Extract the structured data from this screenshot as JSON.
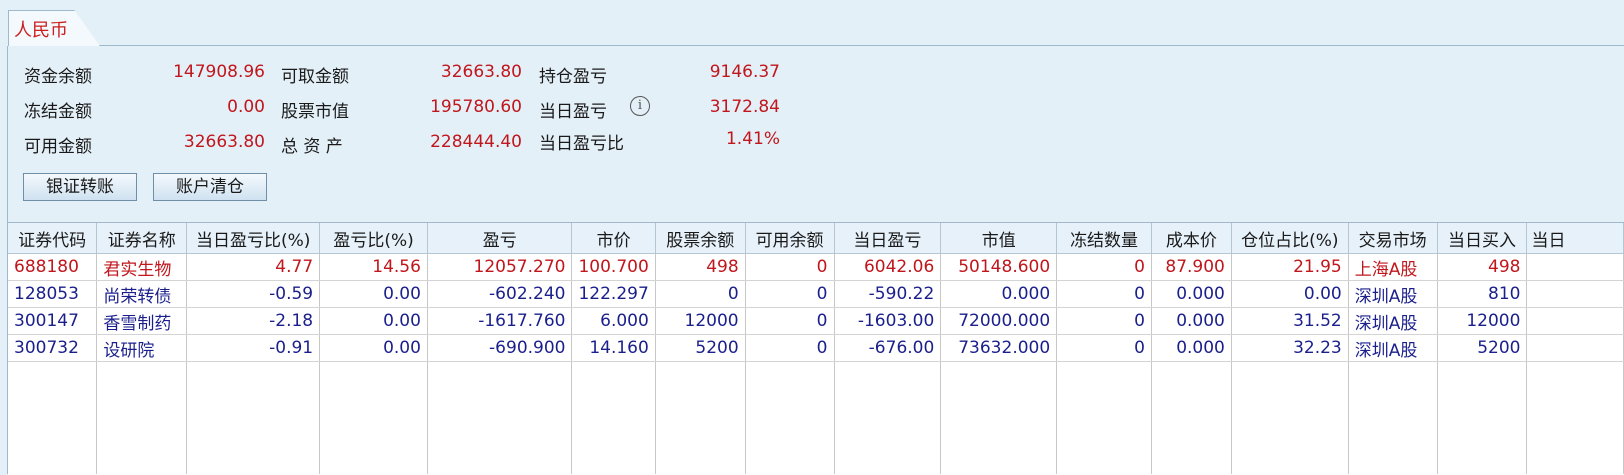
{
  "currency_tab": "人民币",
  "summary": {
    "zijin_label": "资金余额",
    "zijin_value": "147908.96",
    "dongjie_label": "冻结金额",
    "dongjie_value": "0.00",
    "keyong_label": "可用金额",
    "keyong_value": "32663.80",
    "kequ_label": "可取金额",
    "kequ_value": "32663.80",
    "gupiao_label": "股票市值",
    "gupiao_value": "195780.60",
    "zongzichan_label": "总 资 产",
    "zongzichan_value": "228444.40",
    "chicang_label": "持仓盈亏",
    "chicang_value": "9146.37",
    "dangri_label": "当日盈亏",
    "dangri_value": "3172.84",
    "dangribi_label": "当日盈亏比",
    "dangribi_value": "1.41%"
  },
  "buttons": {
    "transfer": "银证转账",
    "clear": "账户清仓"
  },
  "table": {
    "headers": [
      "证券代码",
      "证券名称",
      "当日盈亏比(%)",
      "盈亏比(%)",
      "盈亏",
      "市价",
      "股票余额",
      "可用余额",
      "当日盈亏",
      "市值",
      "冻结数量",
      "成本价",
      "仓位占比(%)",
      "交易市场",
      "当日买入",
      "当日"
    ],
    "rows": [
      [
        "688180",
        "君实生物",
        "4.77",
        "14.56",
        "12057.270",
        "100.700",
        "498",
        "0",
        "6042.06",
        "50148.600",
        "0",
        "87.900",
        "21.95",
        "上海A股",
        "498",
        ""
      ],
      [
        "128053",
        "尚荣转债",
        "-0.59",
        "0.00",
        "-602.240",
        "122.297",
        "0",
        "0",
        "-590.22",
        "0.000",
        "0",
        "0.000",
        "0.00",
        "深圳A股",
        "810",
        ""
      ],
      [
        "300147",
        "香雪制药",
        "-2.18",
        "0.00",
        "-1617.760",
        "6.000",
        "12000",
        "0",
        "-1603.00",
        "72000.000",
        "0",
        "0.000",
        "31.52",
        "深圳A股",
        "12000",
        ""
      ],
      [
        "300732",
        "设研院",
        "-0.91",
        "0.00",
        "-690.900",
        "14.160",
        "5200",
        "0",
        "-676.00",
        "73632.000",
        "0",
        "0.000",
        "32.23",
        "深圳A股",
        "5200",
        ""
      ]
    ],
    "row_colors": [
      "red",
      "blue",
      "blue",
      "blue"
    ]
  },
  "icons": {
    "info": "info-icon"
  },
  "colors": {
    "positive": "#c0161c",
    "negative": "#1a1f8c",
    "background": "#e4f0f8"
  }
}
